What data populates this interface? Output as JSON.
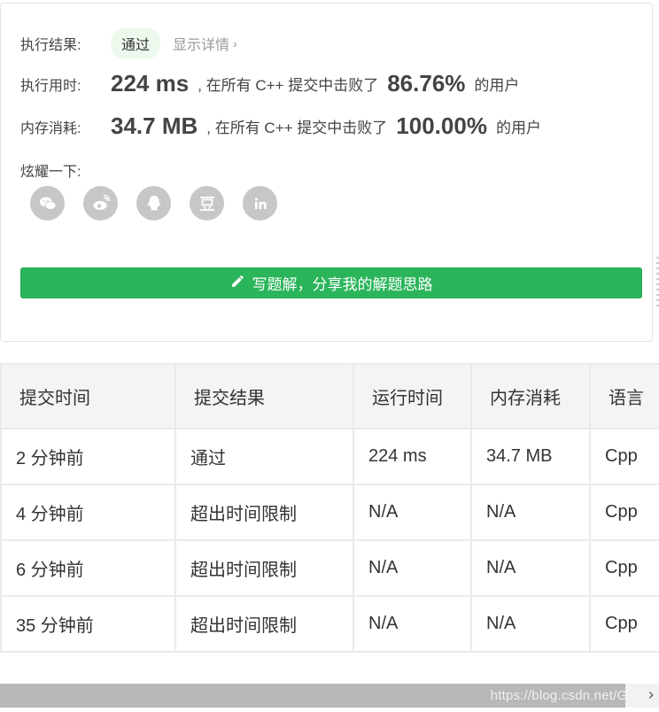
{
  "result": {
    "label": "执行结果:",
    "status": "通过",
    "detail_link": "显示详情"
  },
  "runtime": {
    "label": "执行用时:",
    "value": "224 ms",
    "text_before": ", 在所有 C++ 提交中击败了",
    "percent": "86.76%",
    "text_after": "的用户"
  },
  "memory": {
    "label": "内存消耗:",
    "value": "34.7 MB",
    "text_before": ", 在所有 C++ 提交中击败了",
    "percent": "100.00%",
    "text_after": "的用户"
  },
  "share": {
    "title": "炫耀一下:",
    "icons": [
      "wechat-icon",
      "weibo-icon",
      "qq-icon",
      "douban-icon",
      "linkedin-icon"
    ]
  },
  "write_button": {
    "label": "写题解，分享我的解题思路",
    "color": "#2bb55b"
  },
  "submissions": {
    "headers": [
      "提交时间",
      "提交结果",
      "运行时间",
      "内存消耗",
      "语言"
    ],
    "rows": [
      {
        "time": "2 分钟前",
        "result": "通过",
        "runtime": "224 ms",
        "memory": "34.7 MB",
        "lang": "Cpp"
      },
      {
        "time": "4 分钟前",
        "result": "超出时间限制",
        "runtime": "N/A",
        "memory": "N/A",
        "lang": "Cpp"
      },
      {
        "time": "6 分钟前",
        "result": "超出时间限制",
        "runtime": "N/A",
        "memory": "N/A",
        "lang": "Cpp"
      },
      {
        "time": "35 分钟前",
        "result": "超出时间限制",
        "runtime": "N/A",
        "memory": "N/A",
        "lang": "Cpp"
      }
    ]
  },
  "colors": {
    "pass": "#3bab3b",
    "fail": "#e33d3d"
  },
  "watermark": "https://blog.csdn.net/Gogo"
}
